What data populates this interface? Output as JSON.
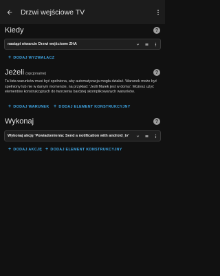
{
  "appbar": {
    "title": "Drzwi wejściowe TV"
  },
  "triggers": {
    "title": "Kiedy",
    "item_label": "nastąpi otwarcie Drzwi wejściowe ZHA",
    "add_label": "DODAJ WYZWALACZ"
  },
  "conditions": {
    "title": "Jeżeli",
    "optional": "(opcjonalne)",
    "description": "Ta lista warunków musi być spełniona, aby automatyzacja mogła działać. Warunek może być spełniony lub nie w danym momencie, na przykład: 'Jeśli Marek jest w domu'. Możesz użyć elementów konstrukcyjnych do tworzenia bardziej skomplikowanych warunków.",
    "add_condition_label": "DODAJ WARUNEK",
    "add_building_block_label": "DODAJ ELEMENT KONSTRUKCYJNY"
  },
  "actions": {
    "title": "Wykonaj",
    "item_label": "Wykonaj akcję 'Powiadomienia: Send a notification with android_tv'",
    "add_action_label": "DODAJ AKCJĘ",
    "add_building_block_label": "DODAJ ELEMENT KONSTRUKCYJNY"
  },
  "colors": {
    "background": "#111111",
    "appbar": "#1c1c1c",
    "accent": "#3fa7e6",
    "card": "#1f1f1f"
  },
  "icons": {
    "back": "arrow-left-icon",
    "more": "dots-vertical-icon",
    "help": "help-circle-icon",
    "expand": "chevron-down-icon",
    "reorder": "drag-handle-icon",
    "menu": "dots-vertical-icon",
    "add": "plus-icon"
  }
}
